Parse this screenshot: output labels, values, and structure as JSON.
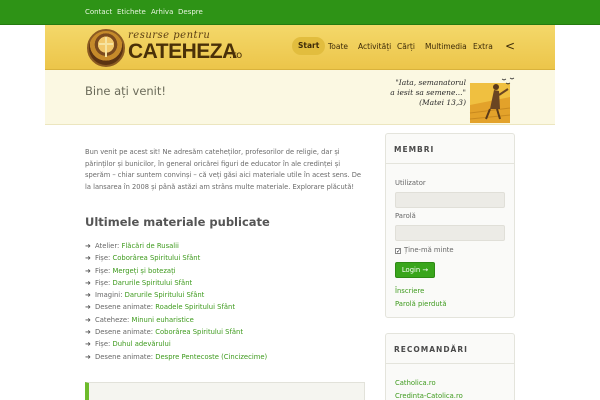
{
  "topnav": [
    "Contact",
    "Etichete",
    "Arhiva",
    "Despre"
  ],
  "logo": {
    "top": "resurse pentru",
    "main": "CATEHEZA",
    "suffix": ".ro"
  },
  "mainnav": [
    "Start",
    "Toate",
    "Activități",
    "Cărți",
    "Multimedia",
    "Extra"
  ],
  "mainnav_more": "<",
  "band": {
    "title": "Bine ați venit!",
    "quote_lines": [
      "\"Iata, semanatorul",
      "a iesit sa semene...\"",
      "(Matei 13,3)"
    ]
  },
  "intro": "Bun venit pe acest sit! Ne adresăm cateheților, profesorilor de religie, dar și părinților și bunicilor, în general oricărei figuri de educator în ale credinței și sperăm – chiar suntem convinși – că veți găsi aici materiale utile în acest sens. De la lansarea în 2008 și până astăzi am strâns multe materiale. Explorare plăcută!",
  "section_title": "Ultimele materiale publicate",
  "recent": [
    {
      "type": "Atelier:",
      "title": "Flăcări de Rusalii"
    },
    {
      "type": "Fișe:",
      "title": "Coborârea Spiritului Sfânt"
    },
    {
      "type": "Fișe:",
      "title": "Mergeți și botezați"
    },
    {
      "type": "Fișe:",
      "title": "Darurile Spiritului Sfânt"
    },
    {
      "type": "Imagini:",
      "title": "Darurile Spiritului Sfânt"
    },
    {
      "type": "Desene animate:",
      "title": "Roadele Spiritului Sfânt"
    },
    {
      "type": "Cateheze:",
      "title": "Minuni euharistice"
    },
    {
      "type": "Desene animate:",
      "title": "Coborârea Spiritului Sfânt"
    },
    {
      "type": "Fișe:",
      "title": "Duhul adevărului"
    },
    {
      "type": "Desene animate:",
      "title": "Despre Pentecoste (Cincizecime)"
    }
  ],
  "members": {
    "title": "MEMBRI",
    "user_label": "Utilizator",
    "pass_label": "Parolă",
    "remember": "Ține-mă minte",
    "login": "Login →",
    "register": "Înscriere",
    "lost": "Parolă pierdută"
  },
  "recommend": {
    "title": "RECOMANDĂRI",
    "links": [
      "Catholica.ro",
      "Credinta-Catolica.ro"
    ]
  },
  "colors": {
    "topbar": "#2e9316",
    "header": "#ecc54a",
    "link": "#3d9a1c",
    "button": "#39a51c"
  }
}
